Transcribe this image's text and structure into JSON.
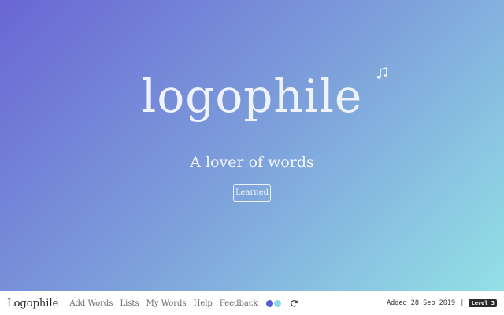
{
  "word": "logophile",
  "definition": "A lover of words",
  "learned_label": "Learned",
  "icons": {
    "audio": "music-note-icon",
    "refresh": "refresh-icon"
  },
  "footer": {
    "brand": "Logophile",
    "nav": [
      "Add Words",
      "Lists",
      "My Words",
      "Help",
      "Feedback"
    ],
    "themes": [
      "#5b5bd6",
      "#8fd9e6"
    ],
    "added": "Added 28 Sep 2019",
    "separator": "|",
    "level": "Level 3"
  },
  "colors": {
    "gradient_start": "#6a66d4",
    "gradient_end": "#93e1e6"
  }
}
